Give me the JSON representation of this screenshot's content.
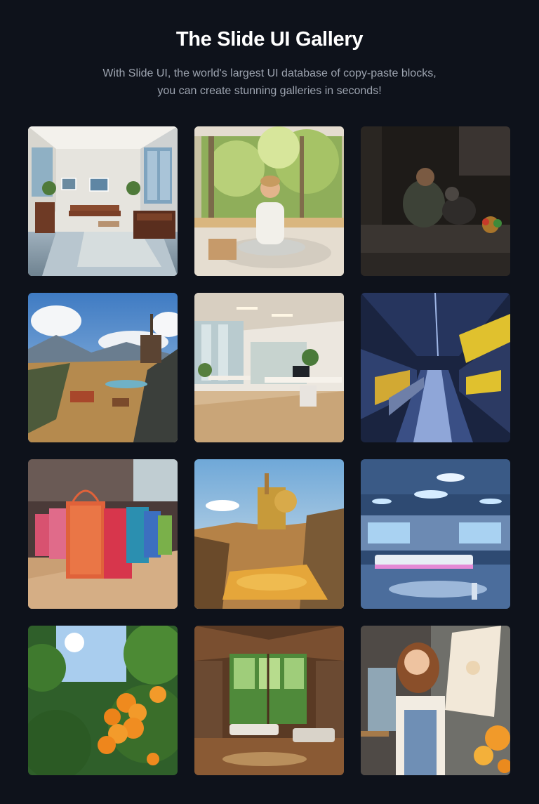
{
  "header": {
    "title": "The Slide UI Gallery",
    "subtitle_line1": "With Slide UI, the world's largest UI database of copy-paste blocks,",
    "subtitle_line2": "you can create stunning galleries in seconds!"
  },
  "colors": {
    "background": "#0e121b",
    "title": "#ffffff",
    "subtitle": "#9ca3af"
  },
  "gallery": {
    "images": [
      {
        "name": "bright-living-room"
      },
      {
        "name": "woman-meditating"
      },
      {
        "name": "man-with-dog"
      },
      {
        "name": "mining-landscape"
      },
      {
        "name": "open-office"
      },
      {
        "name": "factory-conveyor"
      },
      {
        "name": "shopping-bags"
      },
      {
        "name": "desert-refinery"
      },
      {
        "name": "futuristic-lab"
      },
      {
        "name": "orange-tree"
      },
      {
        "name": "wooden-house-interior"
      },
      {
        "name": "smiling-painter"
      }
    ]
  }
}
